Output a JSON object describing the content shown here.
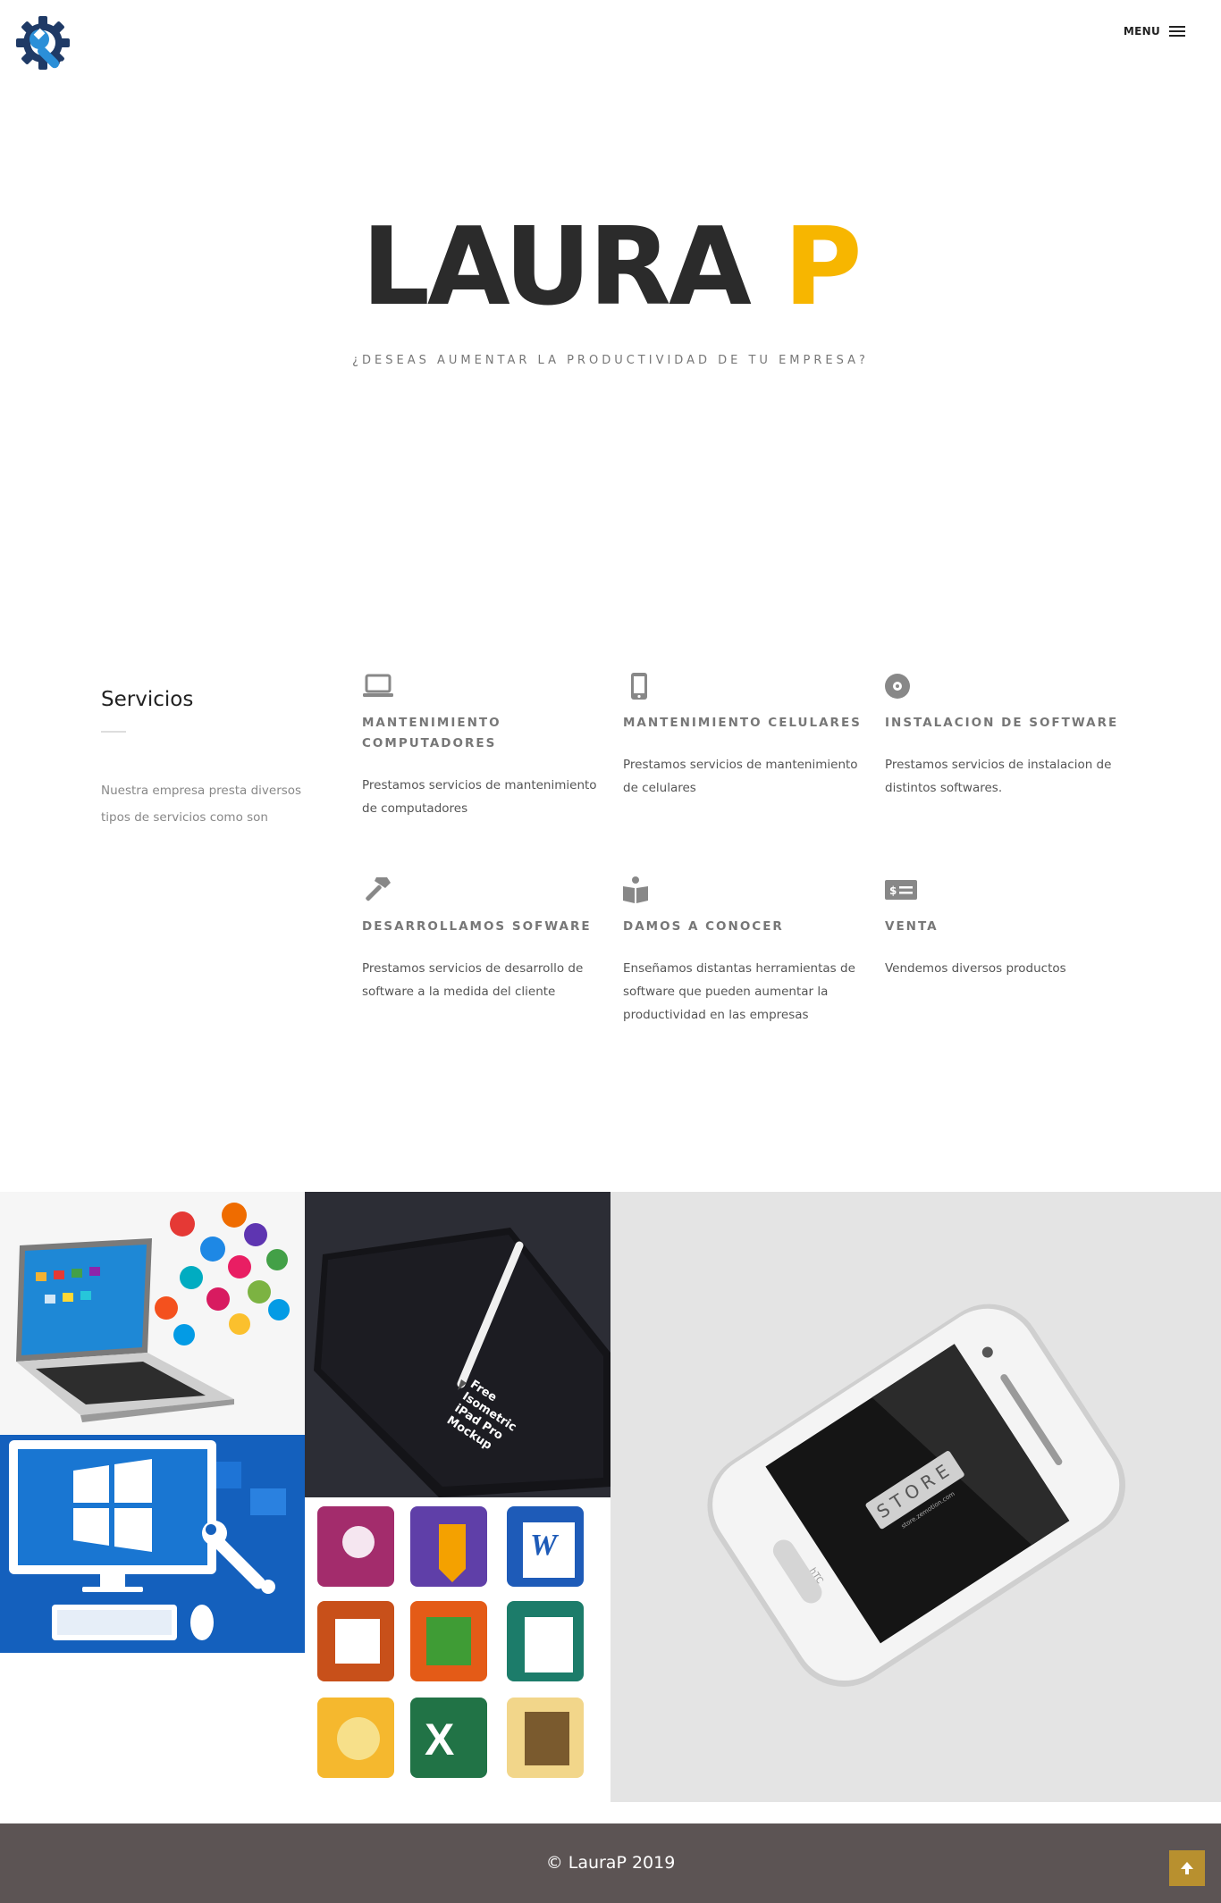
{
  "header": {
    "logo_icon": "gear-wrench-logo-icon",
    "menu_label": "MENU",
    "menu_icon": "hamburger-icon"
  },
  "hero": {
    "title_main": "LAURA ",
    "title_accent": "P",
    "subtitle": "¿DESEAS AUMENTAR LA PRODUCTIVIDAD DE TU EMPRESA?",
    "accent_color": "#f7b600"
  },
  "services": {
    "title": "Servicios",
    "intro": "Nuestra empresa presta diversos tipos de servicios como son",
    "items": [
      {
        "icon": "laptop-icon",
        "title": "MANTENIMIENTO COMPUTADORES",
        "text": "Prestamos servicios de mantenimiento de computadores"
      },
      {
        "icon": "mobile-phone-icon",
        "title": "MANTENIMIENTO CELULARES",
        "text": "Prestamos servicios de mantenimiento de celulares"
      },
      {
        "icon": "disc-icon",
        "title": "INSTALACION DE SOFTWARE",
        "text": "Prestamos servicios de instalacion de distintos softwares."
      },
      {
        "icon": "hammer-icon",
        "title": "DESARROLLAMOS SOFWARE",
        "text": "Prestamos servicios de desarrollo de software a la medida del cliente"
      },
      {
        "icon": "open-book-icon",
        "title": "DAMOS A CONOCER",
        "text": "Enseñamos distantas herramientas de software que pueden aumentar la productividad en las empresas"
      },
      {
        "icon": "money-bill-icon",
        "title": "VENTA",
        "text": "Vendemos diversos productos"
      }
    ]
  },
  "gallery": {
    "tiles": [
      {
        "image": "laptop-with-app-icons-image"
      },
      {
        "image": "ipad-pro-pencil-mockup-image",
        "text_lines": [
          "Free",
          "Isometric",
          "iPad Pro",
          "Mockup"
        ]
      },
      {
        "image": "windows-computer-repair-image"
      },
      {
        "image": "office-application-icons-image"
      },
      {
        "image": "htc-phone-store-mockup-image",
        "brand": "STORE",
        "brand_sub": "store.zemotion.com",
        "phone_brand": "hTC"
      }
    ]
  },
  "footer": {
    "copyright": "© LauraP 2019",
    "back_to_top_icon": "arrow-up-icon",
    "background": "#5c5454",
    "button_color": "#b8902f"
  }
}
